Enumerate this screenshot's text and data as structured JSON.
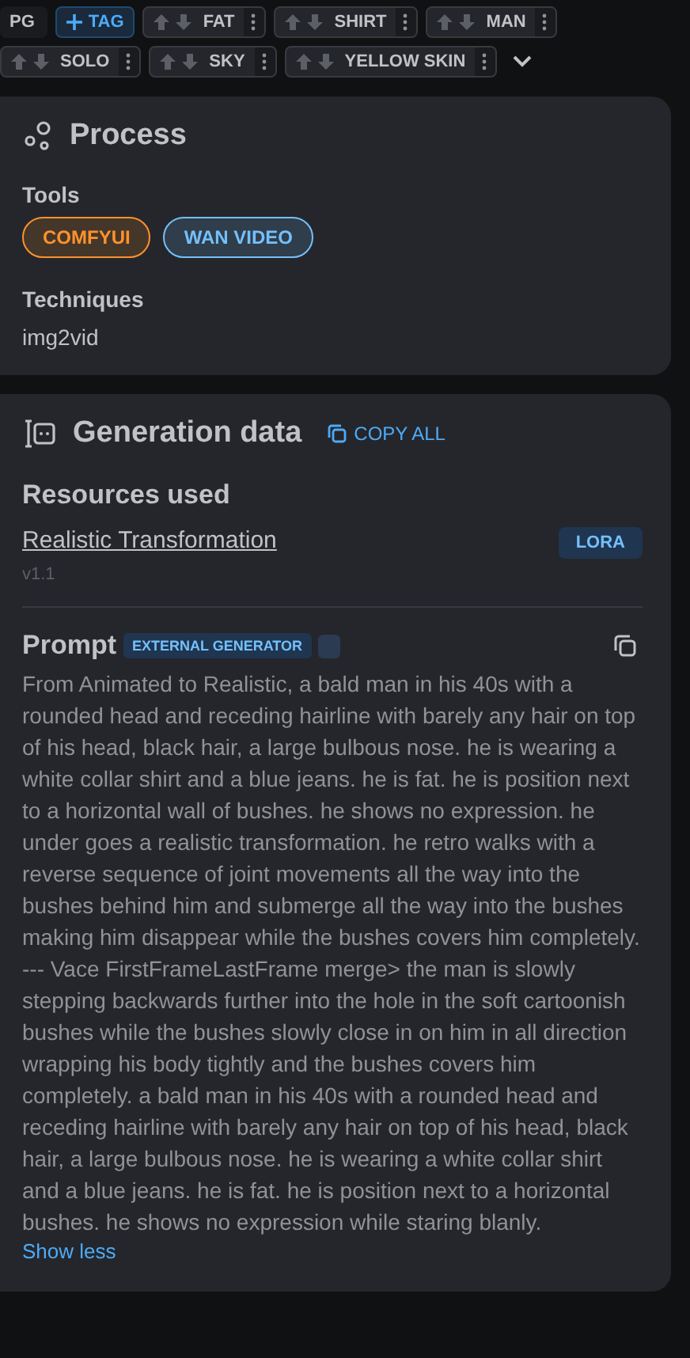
{
  "tags": [
    {
      "kind": "rating",
      "label": "PG"
    },
    {
      "kind": "add",
      "label": "TAG"
    },
    {
      "kind": "vote",
      "label": "FAT"
    },
    {
      "kind": "vote",
      "label": "SHIRT"
    },
    {
      "kind": "vote",
      "label": "MAN"
    },
    {
      "kind": "vote",
      "label": "SOLO"
    },
    {
      "kind": "vote",
      "label": "SKY"
    },
    {
      "kind": "vote",
      "label": "YELLOW SKIN"
    }
  ],
  "tags_expanded": false,
  "process": {
    "title": "Process",
    "tools_label": "Tools",
    "tools": [
      {
        "label": "COMFYUI",
        "color": "#ff922b"
      },
      {
        "label": "WAN VIDEO",
        "color": "#74c0fc"
      }
    ],
    "techniques_label": "Techniques",
    "techniques": [
      "img2vid"
    ]
  },
  "generation": {
    "title": "Generation data",
    "copy_all": "COPY ALL",
    "resources_label": "Resources used",
    "resources": [
      {
        "name": "Realistic Transformation",
        "version": "v1.1",
        "type": "LORA"
      }
    ],
    "prompt": {
      "label": "Prompt",
      "badge": "EXTERNAL GENERATOR",
      "text": "From Animated to Realistic, a bald man in his 40s with a rounded head and receding hairline with barely any hair on top of his head, black hair, a large bulbous nose. he is wearing a white collar shirt and a blue jeans. he is fat. he is position next to a horizontal wall of bushes. he shows no expression. he under goes a realistic transformation. he retro walks with a reverse sequence of joint movements all the way into the bushes behind him and submerge all the way into the bushes making him disappear while the bushes covers him completely. --- Vace FirstFrameLastFrame merge> the man is slowly stepping backwards further into the hole in the soft cartoonish bushes while the bushes slowly close in on him in all direction wrapping his body tightly and the bushes covers him completely. a bald man in his 40s with a rounded head and receding hairline with barely any hair on top of his head, black hair, a large bulbous nose. he is wearing a white collar shirt and a blue jeans. he is fat. he is position next to a horizontal bushes. he shows no expression while staring blanly.",
      "toggle": "Show less"
    }
  }
}
